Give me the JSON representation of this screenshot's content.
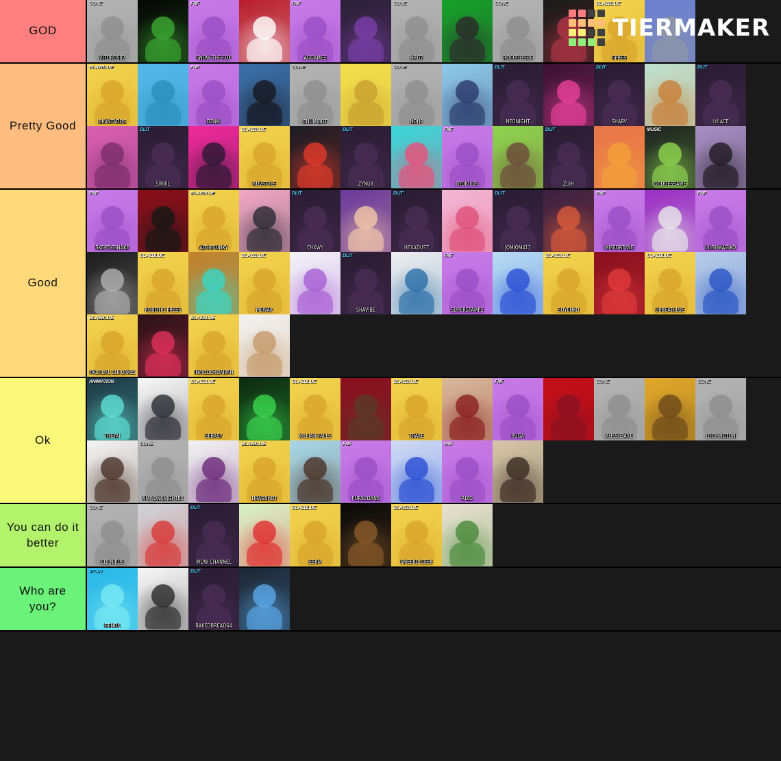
{
  "site": {
    "logo_word": "TIERMAKER",
    "logo_colors": [
      "#ff7d7d",
      "#ff7d7d",
      "#3f3f3f",
      "#3f3f3f",
      "#ffbe7a",
      "#ffbe7a",
      "#ffbe7a",
      "#ffbe7a",
      "#fbf07a",
      "#fbf07a",
      "#3f3f3f",
      "#3f3f3f",
      "#8cf07a",
      "#8cf07a",
      "#8cf07a",
      "#3f3f3f"
    ],
    "background": "#1a1a1a"
  },
  "tiers": [
    {
      "label": "GOD",
      "color": "#ff7f7f",
      "items": [
        {
          "name": "VITORO502",
          "badge": "CONE",
          "badge_color": "grey",
          "bg": "#b3b3b3",
          "accent": "#8f8f8f"
        },
        {
          "name": "",
          "badge": "",
          "badge_color": "white",
          "bg": "#050505",
          "accent": "#3ba832"
        },
        {
          "name": "SNOW THE FOX",
          "badge": "FNF",
          "badge_color": "white",
          "bg": "#c87ae8",
          "accent": "#9a4fc4"
        },
        {
          "name": "",
          "badge": "",
          "badge_color": "white",
          "bg": "#b81d2c",
          "accent": "#ffffff"
        },
        {
          "name": "AGGAMES",
          "badge": "FNF",
          "badge_color": "white",
          "bg": "#c87ae8",
          "accent": "#9a4fc4"
        },
        {
          "name": "",
          "badge": "",
          "badge_color": "white",
          "bg": "#2b2036",
          "accent": "#7a3fa8"
        },
        {
          "name": "MRG7",
          "badge": "CONE",
          "badge_color": "grey",
          "bg": "#b3b3b3",
          "accent": "#8f8f8f"
        },
        {
          "name": "",
          "badge": "",
          "badge_color": "white",
          "bg": "#16a02a",
          "accent": "#2b2b2b"
        },
        {
          "name": "ROCCO 1506",
          "badge": "CONE",
          "badge_color": "grey",
          "bg": "#b3b3b3",
          "accent": "#8f8f8f"
        },
        {
          "name": "",
          "badge": "",
          "badge_color": "white",
          "bg": "#1a1a1a",
          "accent": "#b03545"
        },
        {
          "name": "SPRES",
          "badge": "BLAZBLUE",
          "badge_color": "white",
          "bg": "#f2d24d",
          "accent": "#d8a52c"
        },
        {
          "name": "",
          "badge": "",
          "badge_color": "white",
          "bg": "#6b7fcf",
          "accent": "#8e96a6"
        }
      ]
    },
    {
      "label": "Pretty Good",
      "color": "#ffbe80",
      "items": [
        {
          "name": "BLANTADOS",
          "badge": "BLAZBLUE",
          "badge_color": "white",
          "bg": "#f2d24d",
          "accent": "#d8a52c"
        },
        {
          "name": "",
          "badge": "",
          "badge_color": "white",
          "bg": "#54b8e8",
          "accent": "#2d8fbd"
        },
        {
          "name": "D3NKI",
          "badge": "FNF",
          "badge_color": "white",
          "bg": "#c87ae8",
          "accent": "#9a4fc4"
        },
        {
          "name": "",
          "badge": "",
          "badge_color": "white",
          "bg": "#3b6fa8",
          "accent": "#16171f"
        },
        {
          "name": "CHUM-BOT",
          "badge": "CONE",
          "badge_color": "grey",
          "bg": "#b3b3b3",
          "accent": "#8f8f8f"
        },
        {
          "name": "",
          "badge": "",
          "badge_color": "white",
          "bg": "#f2e04d",
          "accent": "#c8a030"
        },
        {
          "name": "NOHP",
          "badge": "CONE",
          "badge_color": "grey",
          "bg": "#b3b3b3",
          "accent": "#8f8f8f"
        },
        {
          "name": "",
          "badge": "",
          "badge_color": "white",
          "bg": "#8fc9e8",
          "accent": "#2b3a6b"
        },
        {
          "name": "NEONIGHT",
          "badge": "DLIT",
          "badge_color": "blue",
          "bg": "#2b1d33",
          "accent": "#4a2d55"
        },
        {
          "name": "",
          "badge": "",
          "badge_color": "white",
          "bg": "#3a1230",
          "accent": "#e8409b"
        },
        {
          "name": "SHARV",
          "badge": "DLIT",
          "badge_color": "blue",
          "bg": "#2b1d33",
          "accent": "#4a2d55"
        },
        {
          "name": "",
          "badge": "",
          "badge_color": "white",
          "bg": "#bfe0d0",
          "accent": "#c8803a"
        },
        {
          "name": "LYLACE",
          "badge": "DLIT",
          "badge_color": "blue",
          "bg": "#2b1d33",
          "accent": "#4a2d55"
        },
        {
          "name": "",
          "badge": "",
          "badge_color": "white",
          "bg": "#d85fb0",
          "accent": "#7a2d6b"
        },
        {
          "name": "SWIRL",
          "badge": "DLIT",
          "badge_color": "blue",
          "bg": "#2b1d33",
          "accent": "#4a2d55"
        },
        {
          "name": "",
          "badge": "",
          "badge_color": "white",
          "bg": "#f02a9a",
          "accent": "#2b1833"
        },
        {
          "name": "RUVSTYLE",
          "badge": "BLAZBLUE",
          "badge_color": "white",
          "bg": "#f2d24d",
          "accent": "#d8a52c"
        },
        {
          "name": "",
          "badge": "",
          "badge_color": "white",
          "bg": "#1c1c24",
          "accent": "#e03a2a"
        },
        {
          "name": "ZYNUX",
          "badge": "DLIT",
          "badge_color": "blue",
          "bg": "#2b1d33",
          "accent": "#4a2d55"
        },
        {
          "name": "",
          "badge": "",
          "badge_color": "white",
          "bg": "#3ad6d6",
          "accent": "#e8507a"
        },
        {
          "name": "RYOKU 05",
          "badge": "FNF",
          "badge_color": "white",
          "bg": "#c87ae8",
          "accent": "#9a4fc4"
        },
        {
          "name": "",
          "badge": "",
          "badge_color": "white",
          "bg": "#8fd44f",
          "accent": "#6b4a3a"
        },
        {
          "name": "ZUIH",
          "badge": "DLIT",
          "badge_color": "blue",
          "bg": "#2b1d33",
          "accent": "#4a2d55"
        },
        {
          "name": "",
          "badge": "",
          "badge_color": "white",
          "bg": "#e8764a",
          "accent": "#f2a03a"
        },
        {
          "name": "GODDESSAWE",
          "badge": "MUSIC",
          "badge_color": "white",
          "bg": "#1e2420",
          "accent": "#8fd44f"
        },
        {
          "name": "",
          "badge": "",
          "badge_color": "white",
          "bg": "#a88fc4",
          "accent": "#1f1a22"
        }
      ]
    },
    {
      "label": "Good",
      "color": "#ffd97a",
      "items": [
        {
          "name": "SKEPTICSNAKE",
          "badge": "FNF",
          "badge_color": "white",
          "bg": "#c87ae8",
          "accent": "#9a4fc4"
        },
        {
          "name": "",
          "badge": "",
          "badge_color": "white",
          "bg": "#8a0f1a",
          "accent": "#161616"
        },
        {
          "name": "AJTHEFUNKY",
          "badge": "BLAZBLUE",
          "badge_color": "white",
          "bg": "#f2d24d",
          "accent": "#d8a52c"
        },
        {
          "name": "",
          "badge": "",
          "badge_color": "white",
          "bg": "#f2a8c4",
          "accent": "#2b2b33"
        },
        {
          "name": "CHXWY",
          "badge": "DLIT",
          "badge_color": "blue",
          "bg": "#2b1d33",
          "accent": "#4a2d55"
        },
        {
          "name": "",
          "badge": "",
          "badge_color": "white",
          "bg": "#6b3a9a",
          "accent": "#f2c8a8"
        },
        {
          "name": "HEXADUST",
          "badge": "DLIT",
          "badge_color": "blue",
          "bg": "#2b1d33",
          "accent": "#4a2d55"
        },
        {
          "name": "",
          "badge": "",
          "badge_color": "white",
          "bg": "#f2b8d4",
          "accent": "#e0507a"
        },
        {
          "name": "JOMJOM412",
          "badge": "DLIT",
          "badge_color": "blue",
          "bg": "#2b1d33",
          "accent": "#4a2d55"
        },
        {
          "name": "",
          "badge": "",
          "badge_color": "white",
          "bg": "#3a2040",
          "accent": "#d85a3a"
        },
        {
          "name": "MISFORTYNE",
          "badge": "FNF",
          "badge_color": "white",
          "bg": "#c87ae8",
          "accent": "#9a4fc4"
        },
        {
          "name": "",
          "badge": "",
          "badge_color": "white",
          "bg": "#9a2fc4",
          "accent": "#e8e8e8"
        },
        {
          "name": "LILSHMAGIKO",
          "badge": "FNF",
          "badge_color": "white",
          "bg": "#c87ae8",
          "accent": "#9a4fc4"
        },
        {
          "name": "",
          "badge": "",
          "badge_color": "white",
          "bg": "#1c1c1c",
          "accent": "#b0b0b0"
        },
        {
          "name": "ROBOTIC PRESS",
          "badge": "BLAZBLUE",
          "badge_color": "white",
          "bg": "#f2d24d",
          "accent": "#d8a52c"
        },
        {
          "name": "",
          "badge": "",
          "badge_color": "white",
          "bg": "#c4802a",
          "accent": "#3ad6c4"
        },
        {
          "name": "MEWAK",
          "badge": "BLAZBLUE",
          "badge_color": "white",
          "bg": "#f2d24d",
          "accent": "#d8a52c"
        },
        {
          "name": "",
          "badge": "",
          "badge_color": "white",
          "bg": "#f2f2f8",
          "accent": "#a85fd4"
        },
        {
          "name": "SHAVIBE",
          "badge": "DLIT",
          "badge_color": "blue",
          "bg": "#2b1d33",
          "accent": "#4a2d55"
        },
        {
          "name": "",
          "badge": "",
          "badge_color": "white",
          "bg": "#efefef",
          "accent": "#2b6fa8"
        },
        {
          "name": "SUPERSTAMPS",
          "badge": "FNF",
          "badge_color": "white",
          "bg": "#c87ae8",
          "accent": "#9a4fc4"
        },
        {
          "name": "",
          "badge": "",
          "badge_color": "white",
          "bg": "#b8dcf2",
          "accent": "#2a4fd4"
        },
        {
          "name": "SUYENKO",
          "badge": "BLAZBLUE",
          "badge_color": "white",
          "bg": "#f2d24d",
          "accent": "#d8a52c"
        },
        {
          "name": "",
          "badge": "",
          "badge_color": "white",
          "bg": "#8a1020",
          "accent": "#e03a3a"
        },
        {
          "name": "UPBEATBLUE",
          "badge": "BLAZBLUE",
          "badge_color": "white",
          "bg": "#f2d24d",
          "accent": "#d8a52c"
        },
        {
          "name": "",
          "badge": "",
          "badge_color": "white",
          "bg": "#b8cde8",
          "accent": "#2a55c4"
        },
        {
          "name": "TACTICAL CUPCAKES",
          "badge": "BLAZBLUE",
          "badge_color": "white",
          "bg": "#f2d24d",
          "accent": "#d8a52c"
        },
        {
          "name": "",
          "badge": "",
          "badge_color": "white",
          "bg": "#2b1218",
          "accent": "#e0305a"
        },
        {
          "name": "INAICOCHOAIPAN",
          "badge": "BLAZBLUE",
          "badge_color": "white",
          "bg": "#f2d24d",
          "accent": "#d8a52c"
        },
        {
          "name": "",
          "badge": "",
          "badge_color": "white",
          "bg": "#f2f2f2",
          "accent": "#c49a6b"
        }
      ]
    },
    {
      "label": "Ok",
      "color": "#fbf87a",
      "items": [
        {
          "name": "TREYAI",
          "badge": "ANIMATION",
          "badge_color": "white",
          "bg": "#1e3a44",
          "accent": "#5fe0d4"
        },
        {
          "name": "",
          "badge": "",
          "badge_color": "white",
          "bg": "#f8f8f8",
          "accent": "#2b2b33"
        },
        {
          "name": "SEBASY",
          "badge": "BLAZBLUE",
          "badge_color": "white",
          "bg": "#f2d24d",
          "accent": "#d8a52c"
        },
        {
          "name": "",
          "badge": "",
          "badge_color": "white",
          "bg": "#0d2b10",
          "accent": "#3ad44f"
        },
        {
          "name": "KILLIAN FALLS",
          "badge": "BLAZBLUE",
          "badge_color": "white",
          "bg": "#f2d24d",
          "accent": "#d8a52c"
        },
        {
          "name": "",
          "badge": "",
          "badge_color": "white",
          "bg": "#8a1020",
          "accent": "#5a3a2a"
        },
        {
          "name": "TRAKE",
          "badge": "BLAZBLUE",
          "badge_color": "white",
          "bg": "#f2d24d",
          "accent": "#d8a52c"
        },
        {
          "name": "",
          "badge": "",
          "badge_color": "white",
          "bg": "#d8b89a",
          "accent": "#8a2020"
        },
        {
          "name": "PUGA",
          "badge": "FNF",
          "badge_color": "white",
          "bg": "#c87ae8",
          "accent": "#9a4fc4"
        },
        {
          "name": "",
          "badge": "",
          "badge_color": "white",
          "bg": "#c40f18",
          "accent": "#8a1020"
        },
        {
          "name": "AUSSIE AXE",
          "badge": "CONE",
          "badge_color": "grey",
          "bg": "#b3b3b3",
          "accent": "#8f8f8f"
        },
        {
          "name": "",
          "badge": "",
          "badge_color": "white",
          "bg": "#e0a82a",
          "accent": "#6b4a1a"
        },
        {
          "name": "LOOPINGTON",
          "badge": "CONE",
          "badge_color": "grey",
          "bg": "#b3b3b3",
          "accent": "#8f8f8f"
        },
        {
          "name": "",
          "badge": "",
          "badge_color": "white",
          "bg": "#f4f4f4",
          "accent": "#4a3328"
        },
        {
          "name": "AMPIONKNIGHTEX",
          "badge": "CONE",
          "badge_color": "grey",
          "bg": "#b3b3b3",
          "accent": "#8f8f8f"
        },
        {
          "name": "",
          "badge": "",
          "badge_color": "white",
          "bg": "#f2f2f2",
          "accent": "#6b2a7a"
        },
        {
          "name": "DRAGSHOT",
          "badge": "BLAZBLUE",
          "badge_color": "white",
          "bg": "#f2d24d",
          "accent": "#d8a52c"
        },
        {
          "name": "",
          "badge": "",
          "badge_color": "white",
          "bg": "#a8d8e8",
          "accent": "#4a3328"
        },
        {
          "name": "FURSCOANS",
          "badge": "FNF",
          "badge_color": "white",
          "bg": "#c87ae8",
          "accent": "#9a4fc4"
        },
        {
          "name": "",
          "badge": "",
          "badge_color": "white",
          "bg": "#cfdcf4",
          "accent": "#2a4fd4"
        },
        {
          "name": "RIZO",
          "badge": "FNF",
          "badge_color": "white",
          "bg": "#c87ae8",
          "accent": "#9a4fc4"
        },
        {
          "name": "",
          "badge": "",
          "badge_color": "white",
          "bg": "#d8c8a8",
          "accent": "#3a2a22"
        }
      ]
    },
    {
      "label": "You can do it better",
      "color": "#b3f26b",
      "items": [
        {
          "name": "COLNIRUS",
          "badge": "CONE",
          "badge_color": "grey",
          "bg": "#b3b3b3",
          "accent": "#8f8f8f"
        },
        {
          "name": "",
          "badge": "",
          "badge_color": "white",
          "bg": "#cfd4d8",
          "accent": "#d83a3a"
        },
        {
          "name": "WOW CHANNEL",
          "badge": "DLIT",
          "badge_color": "blue",
          "bg": "#2b1d33",
          "accent": "#4a2d55"
        },
        {
          "name": "",
          "badge": "",
          "badge_color": "white",
          "bg": "#d8f2c8",
          "accent": "#e03030"
        },
        {
          "name": "EEKM",
          "badge": "BLAZBLUE",
          "badge_color": "white",
          "bg": "#f2d24d",
          "accent": "#d8a52c"
        },
        {
          "name": "",
          "badge": "",
          "badge_color": "white",
          "bg": "#0a0a0a",
          "accent": "#8a5a2a"
        },
        {
          "name": "SMEEKO GEEK",
          "badge": "BLAZBLUE",
          "badge_color": "white",
          "bg": "#f2d24d",
          "accent": "#d8a52c"
        },
        {
          "name": "",
          "badge": "",
          "badge_color": "white",
          "bg": "#e8e0d0",
          "accent": "#4a8a3a"
        }
      ]
    },
    {
      "label": "Who are you?",
      "color": "#6bf279",
      "items": [
        {
          "name": "GENOX",
          "badge": "IFTAN",
          "badge_color": "blue",
          "bg": "#2ab8e8",
          "accent": "#7ae8f2"
        },
        {
          "name": "",
          "badge": "",
          "badge_color": "white",
          "bg": "#f8f8f8",
          "accent": "#2b2b2b"
        },
        {
          "name": "BAKEDBREAD64",
          "badge": "DLIT",
          "badge_color": "blue",
          "bg": "#2b1d33",
          "accent": "#4a2d55"
        },
        {
          "name": "",
          "badge": "",
          "badge_color": "white",
          "bg": "#1c2633",
          "accent": "#5aa8e8"
        }
      ]
    }
  ]
}
